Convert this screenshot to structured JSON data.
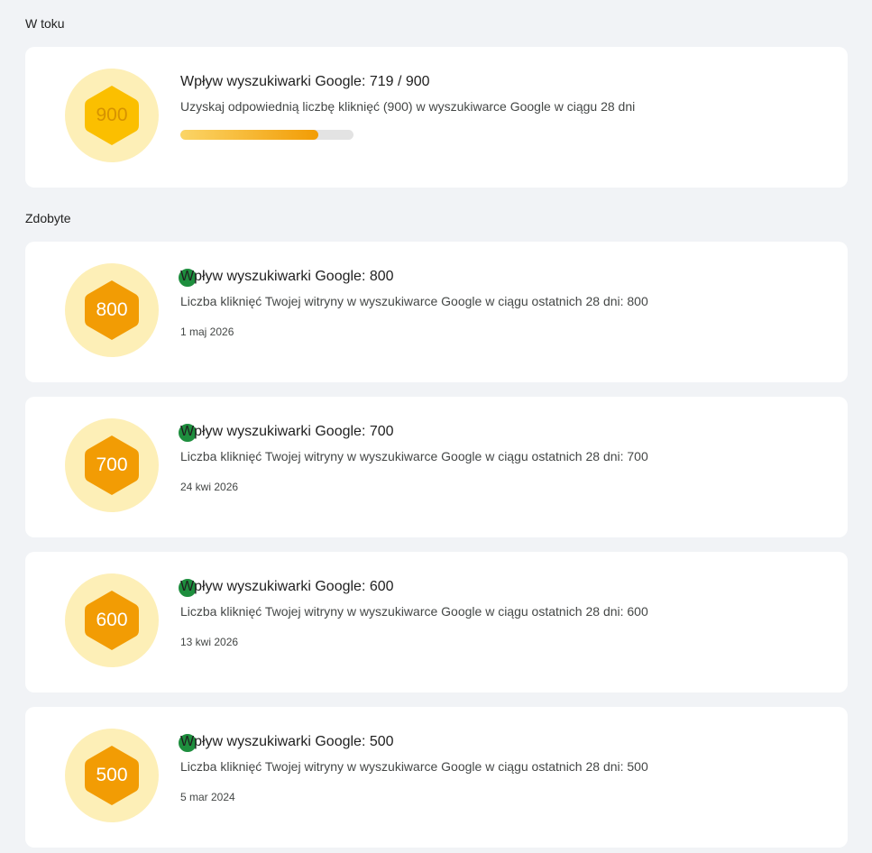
{
  "in_progress": {
    "section_title": "W toku",
    "card": {
      "badge_number": "900",
      "title": "Wpływ wyszukiwarki Google: 719 / 900",
      "description": "Uzyskaj odpowiednią liczbę kliknięć (900) w wyszukiwarce Google w ciągu 28 dni",
      "progress_fraction": 0.799,
      "badge_color": "#fbbf00",
      "number_color": "#d69200"
    }
  },
  "earned": {
    "section_title": "Zdobyte",
    "badge_color": "#f29c04",
    "check_color": "#1e8e3e",
    "items": [
      {
        "badge_number": "800",
        "title": "Wpływ wyszukiwarki Google: 800",
        "description": "Liczba kliknięć Twojej witryny w wyszukiwarce Google w ciągu ostatnich 28 dni: 800",
        "date": "1 maj 2026"
      },
      {
        "badge_number": "700",
        "title": "Wpływ wyszukiwarki Google: 700",
        "description": "Liczba kliknięć Twojej witryny w wyszukiwarce Google w ciągu ostatnich 28 dni: 700",
        "date": "24 kwi 2026"
      },
      {
        "badge_number": "600",
        "title": "Wpływ wyszukiwarki Google: 600",
        "description": "Liczba kliknięć Twojej witryny w wyszukiwarce Google w ciągu ostatnich 28 dni: 600",
        "date": "13 kwi 2026"
      },
      {
        "badge_number": "500",
        "title": "Wpływ wyszukiwarki Google: 500",
        "description": "Liczba kliknięć Twojej witryny w wyszukiwarce Google w ciągu ostatnich 28 dni: 500",
        "date": "5 mar 2024"
      }
    ]
  }
}
